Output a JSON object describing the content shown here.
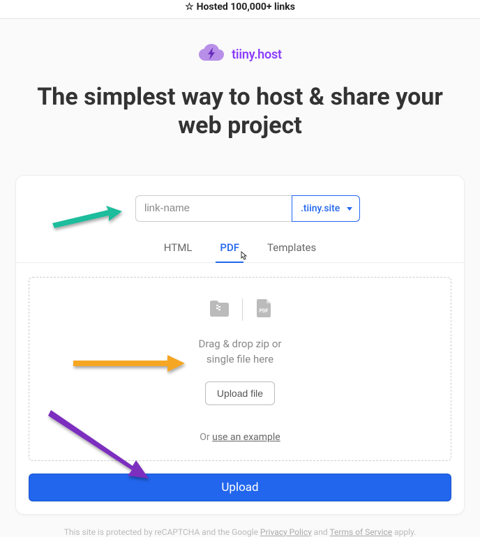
{
  "banner": {
    "text": "Hosted 100,000+ links"
  },
  "logo": {
    "text": "tiiny.host"
  },
  "hero": {
    "title": "The simplest way to host & share your web project"
  },
  "input": {
    "placeholder": "link-name",
    "domain": ".tiiny.site"
  },
  "tabs": {
    "html": "HTML",
    "pdf": "PDF",
    "templates": "Templates",
    "active": "pdf"
  },
  "dropzone": {
    "text_line1": "Drag & drop zip or",
    "text_line2": "single file here",
    "upload_file_label": "Upload file",
    "or_text": "Or ",
    "example_link": "use an example"
  },
  "upload_button": "Upload",
  "footer": {
    "prefix": "This site is protected by reCAPTCHA and the Google ",
    "privacy": "Privacy Policy",
    "and": " and ",
    "terms": "Terms of Service",
    "suffix": " apply."
  }
}
